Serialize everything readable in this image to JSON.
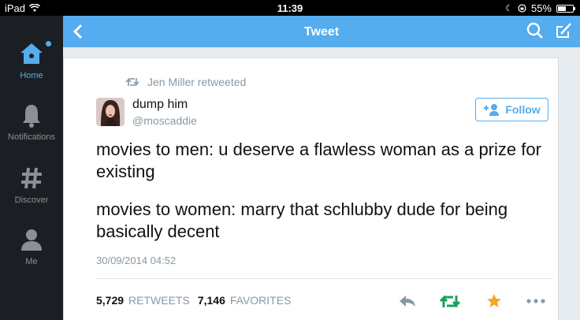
{
  "status_bar": {
    "device": "iPad",
    "time": "11:39",
    "battery": "55%",
    "battery_level": 0.55
  },
  "sidebar": {
    "items": [
      {
        "label": "Home",
        "icon": "home-icon",
        "active": true
      },
      {
        "label": "Notifications",
        "icon": "bell-icon",
        "active": false
      },
      {
        "label": "Discover",
        "icon": "hashtag-icon",
        "active": false
      },
      {
        "label": "Me",
        "icon": "person-icon",
        "active": false
      }
    ]
  },
  "header": {
    "title": "Tweet",
    "back_icon": "chevron-left-icon",
    "search_icon": "search-icon",
    "compose_icon": "compose-icon"
  },
  "tweet": {
    "retweeted_by": "Jen Miller retweeted",
    "user_name": "dump him",
    "handle": "@moscaddie",
    "follow_label": "Follow",
    "text_lines": [
      "movies to men: u deserve a flawless woman as a prize for existing",
      "movies to women: marry that schlubby dude for being basically decent"
    ],
    "timestamp": "30/09/2014 04:52",
    "retweets_count": "5,729",
    "retweets_label": "RETWEETS",
    "favorites_count": "7,146",
    "favorites_label": "FAVORITES",
    "accent": "#55acee",
    "star_color": "#f5a623",
    "retweet_green": "#19a15f"
  }
}
